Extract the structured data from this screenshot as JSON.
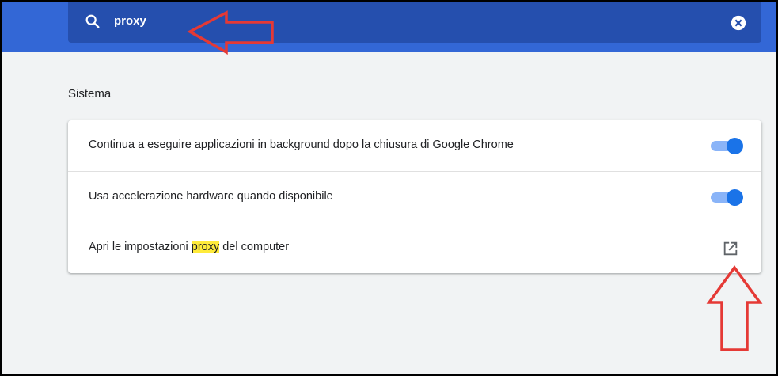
{
  "search": {
    "query": "proxy",
    "icon": "search-icon",
    "clear_icon": "clear-icon"
  },
  "section": {
    "title": "Sistema"
  },
  "settings": [
    {
      "label": "Continua a eseguire applicazioni in background dopo la chiusura di Google Chrome",
      "control": "toggle",
      "on": true
    },
    {
      "label": "Usa accelerazione hardware quando disponibile",
      "control": "toggle",
      "on": true
    },
    {
      "label_before": "Apri le impostazioni ",
      "label_highlight": "proxy",
      "label_after": " del computer",
      "control": "external-link",
      "icon": "open-in-new-icon"
    }
  ],
  "colors": {
    "header": "#3367d6",
    "search_bg": "#254fae",
    "toggle_track": "#8ab4f8",
    "toggle_knob": "#1a73e8",
    "highlight": "#ffeb3b",
    "annotation_arrow": "#e53935"
  }
}
